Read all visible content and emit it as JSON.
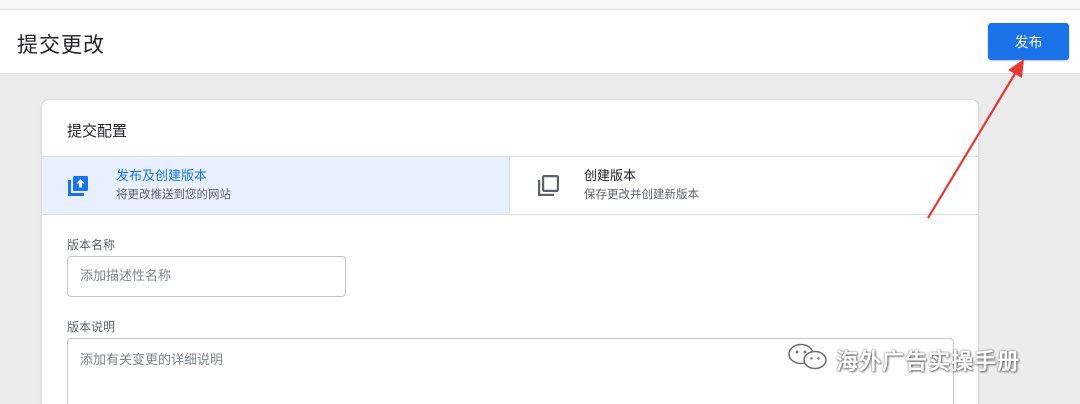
{
  "header": {
    "title": "提交更改",
    "publish_label": "发布"
  },
  "card": {
    "title": "提交配置",
    "options": [
      {
        "title": "发布及创建版本",
        "subtitle": "将更改推送到您的网站",
        "icon": "publish-upload-icon",
        "selected": true
      },
      {
        "title": "创建版本",
        "subtitle": "保存更改并创建新版本",
        "icon": "copy-version-icon",
        "selected": false
      }
    ],
    "version_name": {
      "label": "版本名称",
      "placeholder": "添加描述性名称",
      "value": ""
    },
    "version_description": {
      "label": "版本说明",
      "placeholder": "添加有关变更的详细说明",
      "value": ""
    }
  },
  "watermark": {
    "text": "海外广告实操手册",
    "icon": "wechat-icon"
  },
  "colors": {
    "accent": "#1a73e8",
    "selected_bg": "#e8f0fe",
    "arrow": "#e53935"
  }
}
